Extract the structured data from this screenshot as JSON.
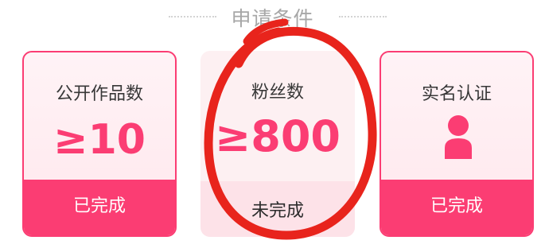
{
  "header": {
    "title": "申请条件"
  },
  "cards": [
    {
      "label": "公开作品数",
      "value": "≥10",
      "status": "已完成"
    },
    {
      "label": "粉丝数",
      "value": "≥800",
      "status": "未完成"
    },
    {
      "label": "实名认证",
      "icon": "user-icon",
      "status": "已完成"
    }
  ],
  "colors": {
    "accent": "#fb3d73",
    "pending_bg": "#fde2e8",
    "annotation": "#e8241c"
  }
}
